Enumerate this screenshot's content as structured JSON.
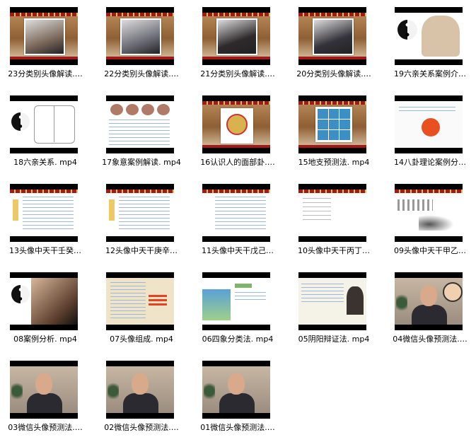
{
  "files": [
    {
      "label": "23分类别头像解读.…",
      "thumb": "room-photo",
      "photo_color": "#7d6a5c"
    },
    {
      "label": "22分类别头像解读.…",
      "thumb": "room-photo",
      "photo_color": "#6e6e78"
    },
    {
      "label": "21分类别头像解读.…",
      "thumb": "room-photo",
      "photo_color": "#2e2a2c"
    },
    {
      "label": "20分类别头像解读.…",
      "thumb": "room-photo",
      "photo_color": "#34323a"
    },
    {
      "label": "19六亲关系案例介…",
      "thumb": "taiji-stone",
      "photo_color": "#d8c3a8"
    },
    {
      "label": "18六亲关系. mp4",
      "thumb": "taiji-diagram",
      "photo_color": "#c0a080"
    },
    {
      "label": "17象意案例解读. mp4",
      "thumb": "faces-table",
      "photo_color": "#b07b66"
    },
    {
      "label": "16认识人的面部卦.…",
      "thumb": "room-cartoon",
      "photo_color": "#d9b24d"
    },
    {
      "label": "15地支预测法. mp4",
      "thumb": "room-grid",
      "photo_color": "#3c8fc4"
    },
    {
      "label": "14八卦理论案例分…",
      "thumb": "slide-heart",
      "photo_color": "#e8501f"
    },
    {
      "label": "13头像中天干壬癸…",
      "thumb": "table-slide",
      "photo_color": "#e0a800"
    },
    {
      "label": "12头像中天干庚辛…",
      "thumb": "table-slide",
      "photo_color": "#e0a800"
    },
    {
      "label": "11头像中天干戊己…",
      "thumb": "table-slide2",
      "photo_color": "#e0a800"
    },
    {
      "label": "10头像中天干丙丁…",
      "thumb": "text-slide",
      "photo_color": "#bbbbbb"
    },
    {
      "label": "09头像中天干甲乙…",
      "thumb": "ink-slide",
      "photo_color": "#555555"
    },
    {
      "label": "08案例分析. mp4",
      "thumb": "eye-photo",
      "photo_color": "#5a3d2c"
    },
    {
      "label": "07头像组成. mp4",
      "thumb": "paper-slide",
      "photo_color": "#e84020"
    },
    {
      "label": "06四象分类法. mp4",
      "thumb": "spring-slide",
      "photo_color": "#5aa0d8"
    },
    {
      "label": "05阴阳辩证法. mp4",
      "thumb": "text-man",
      "photo_color": "#3a3330"
    },
    {
      "label": "04微信头像预测法.…",
      "thumb": "presenter-cartoon",
      "photo_color": "#2b2a30"
    },
    {
      "label": "03微信头像预测法.…",
      "thumb": "presenter",
      "photo_color": "#2b2a30"
    },
    {
      "label": "02微信头像预测法.…",
      "thumb": "presenter",
      "photo_color": "#2b2a30"
    },
    {
      "label": "01微信头像预测法.…",
      "thumb": "presenter",
      "photo_color": "#2b2a30"
    }
  ]
}
